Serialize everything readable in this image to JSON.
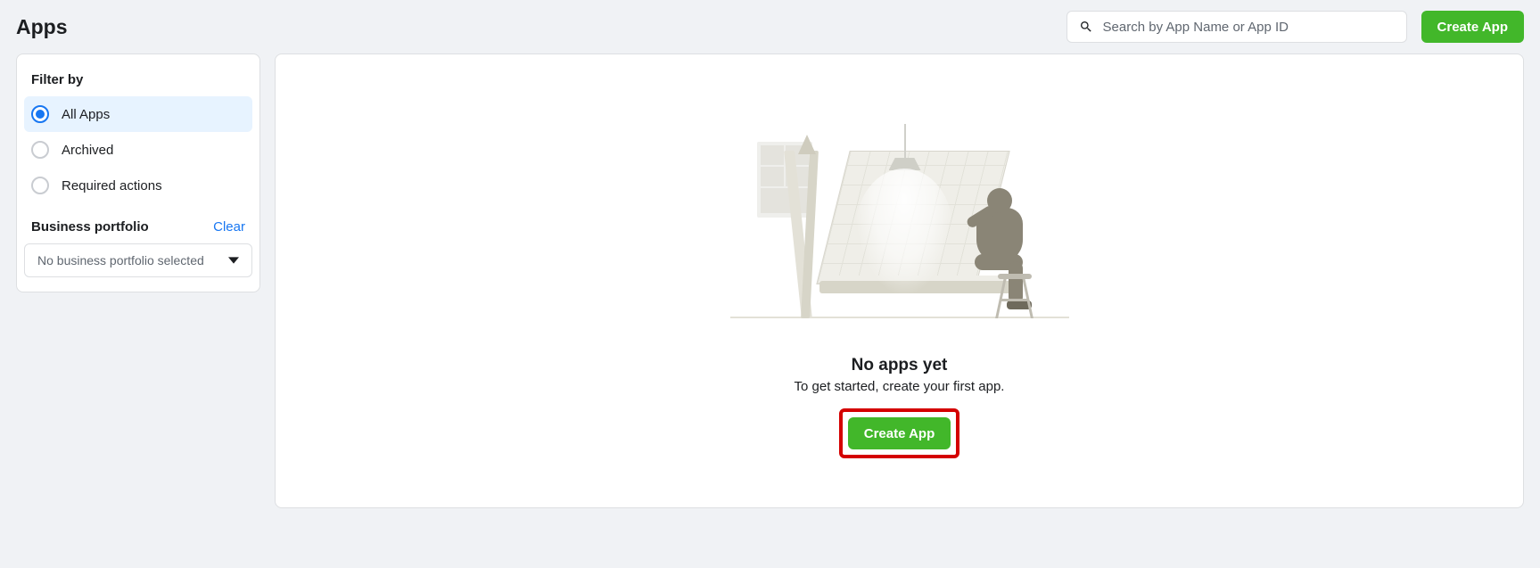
{
  "header": {
    "title": "Apps",
    "search_placeholder": "Search by App Name or App ID",
    "create_label": "Create App"
  },
  "sidebar": {
    "filter_title": "Filter by",
    "filters": [
      {
        "label": "All Apps",
        "selected": true
      },
      {
        "label": "Archived",
        "selected": false
      },
      {
        "label": "Required actions",
        "selected": false
      }
    ],
    "portfolio": {
      "title": "Business portfolio",
      "clear_label": "Clear",
      "selected_label": "No business portfolio selected"
    }
  },
  "main": {
    "empty_title": "No apps yet",
    "empty_subtitle": "To get started, create your first app.",
    "create_label": "Create App"
  },
  "colors": {
    "primary_green": "#42b72a",
    "link_blue": "#1877f2",
    "highlight_red": "#d40000"
  }
}
